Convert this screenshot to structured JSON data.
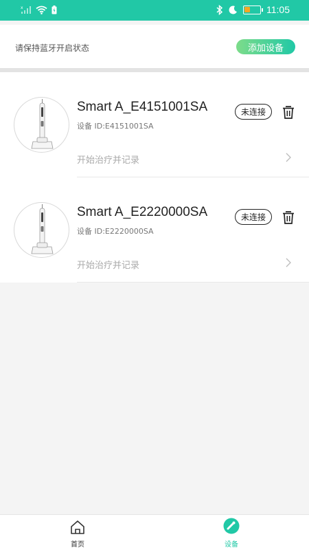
{
  "status_bar": {
    "time": "11:05",
    "battery_level": 0.35,
    "icons": [
      "no-signal-icon",
      "wifi-icon",
      "charging-icon",
      "bluetooth-icon",
      "moon-icon",
      "battery-icon"
    ]
  },
  "header": {
    "hint": "请保持蓝牙开启状态",
    "add_button_label": "添加设备"
  },
  "devices": [
    {
      "name": "Smart A_E4151001SA",
      "id_label": "设备 ID:E4151001SA",
      "status": "未连接",
      "action": "开始治疗并记录"
    },
    {
      "name": "Smart A_E2220000SA",
      "id_label": "设备 ID:E2220000SA",
      "status": "未连接",
      "action": "开始治疗并记录"
    }
  ],
  "bottom_nav": {
    "items": [
      {
        "label": "首页",
        "icon": "home-icon",
        "active": false
      },
      {
        "label": "设备",
        "icon": "device-icon",
        "active": true
      }
    ]
  },
  "colors": {
    "accent": "#21c8a6",
    "add_button_gradient_start": "#7ddc8a"
  }
}
